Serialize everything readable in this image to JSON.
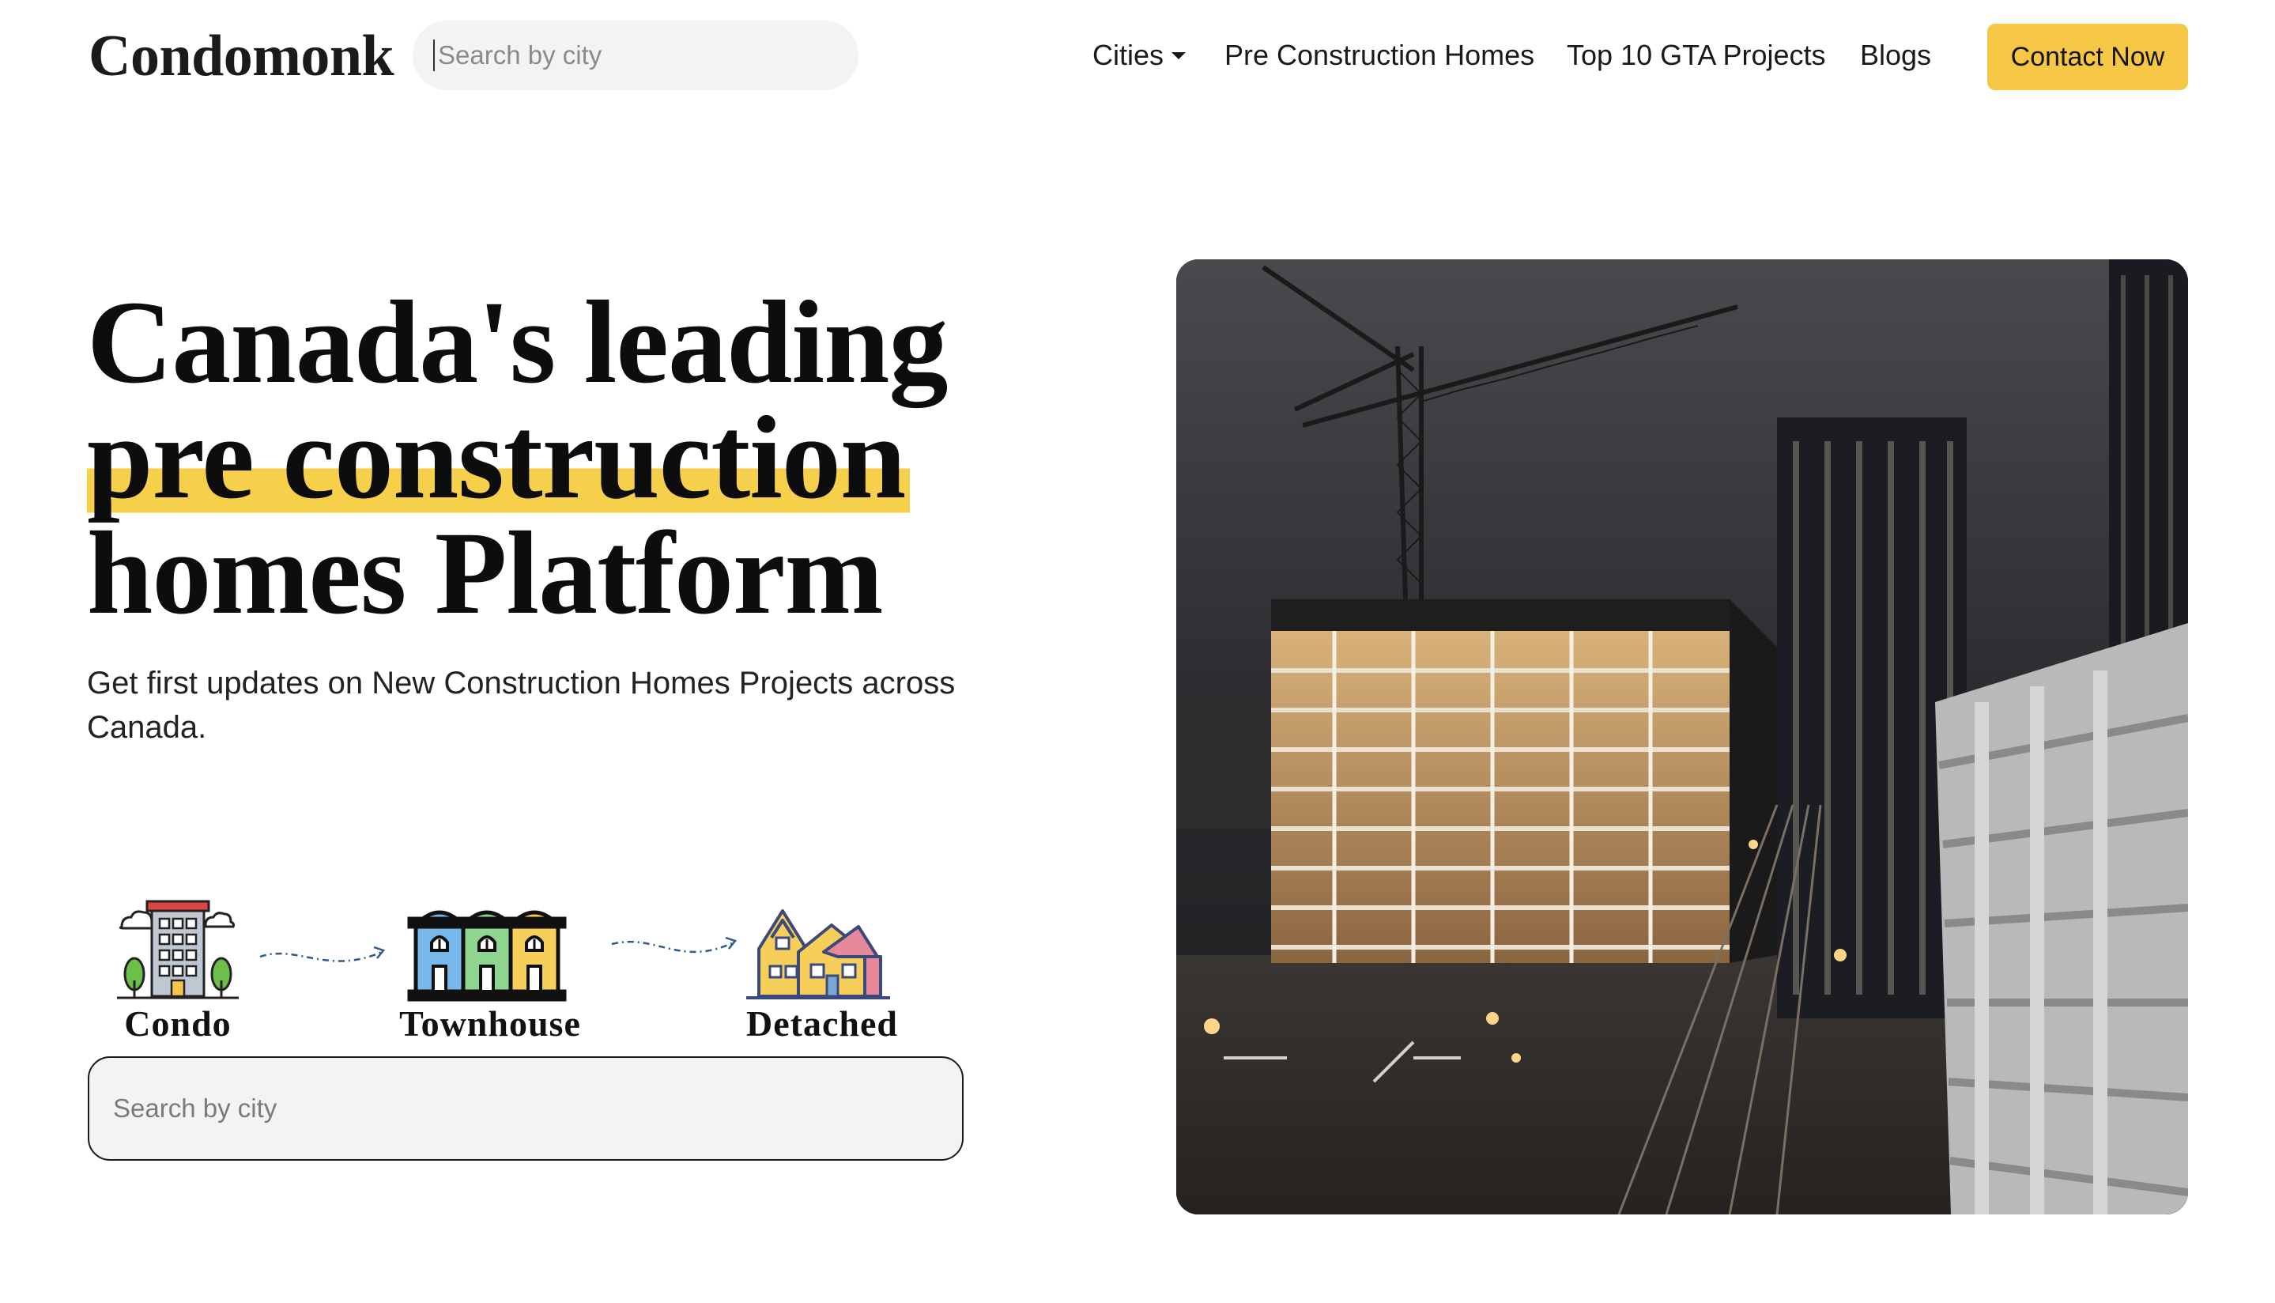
{
  "header": {
    "logo": "Condomonk",
    "search_placeholder": "Search by city",
    "nav": {
      "cities": "Cities",
      "pre_construction": "Pre Construction Homes",
      "top10": "Top 10 GTA Projects",
      "blogs": "Blogs"
    },
    "contact_label": "Contact Now"
  },
  "hero": {
    "title_line1": "Canada's leading",
    "title_line2": "pre construction",
    "title_line3": "homes Platform",
    "subtitle": "Get first updates on New Construction Homes Projects across Canada."
  },
  "property_types": {
    "condo": "Condo",
    "townhouse": "Townhouse",
    "detached": "Detached"
  },
  "main_search": {
    "placeholder": "Search by city"
  },
  "colors": {
    "accent": "#f6c744",
    "highlight": "#f6cf4b",
    "text": "#111111"
  },
  "icons": [
    "condo-building-icon",
    "townhouse-icon",
    "detached-house-icon",
    "dotted-arrow-icon",
    "caret-down-icon"
  ]
}
